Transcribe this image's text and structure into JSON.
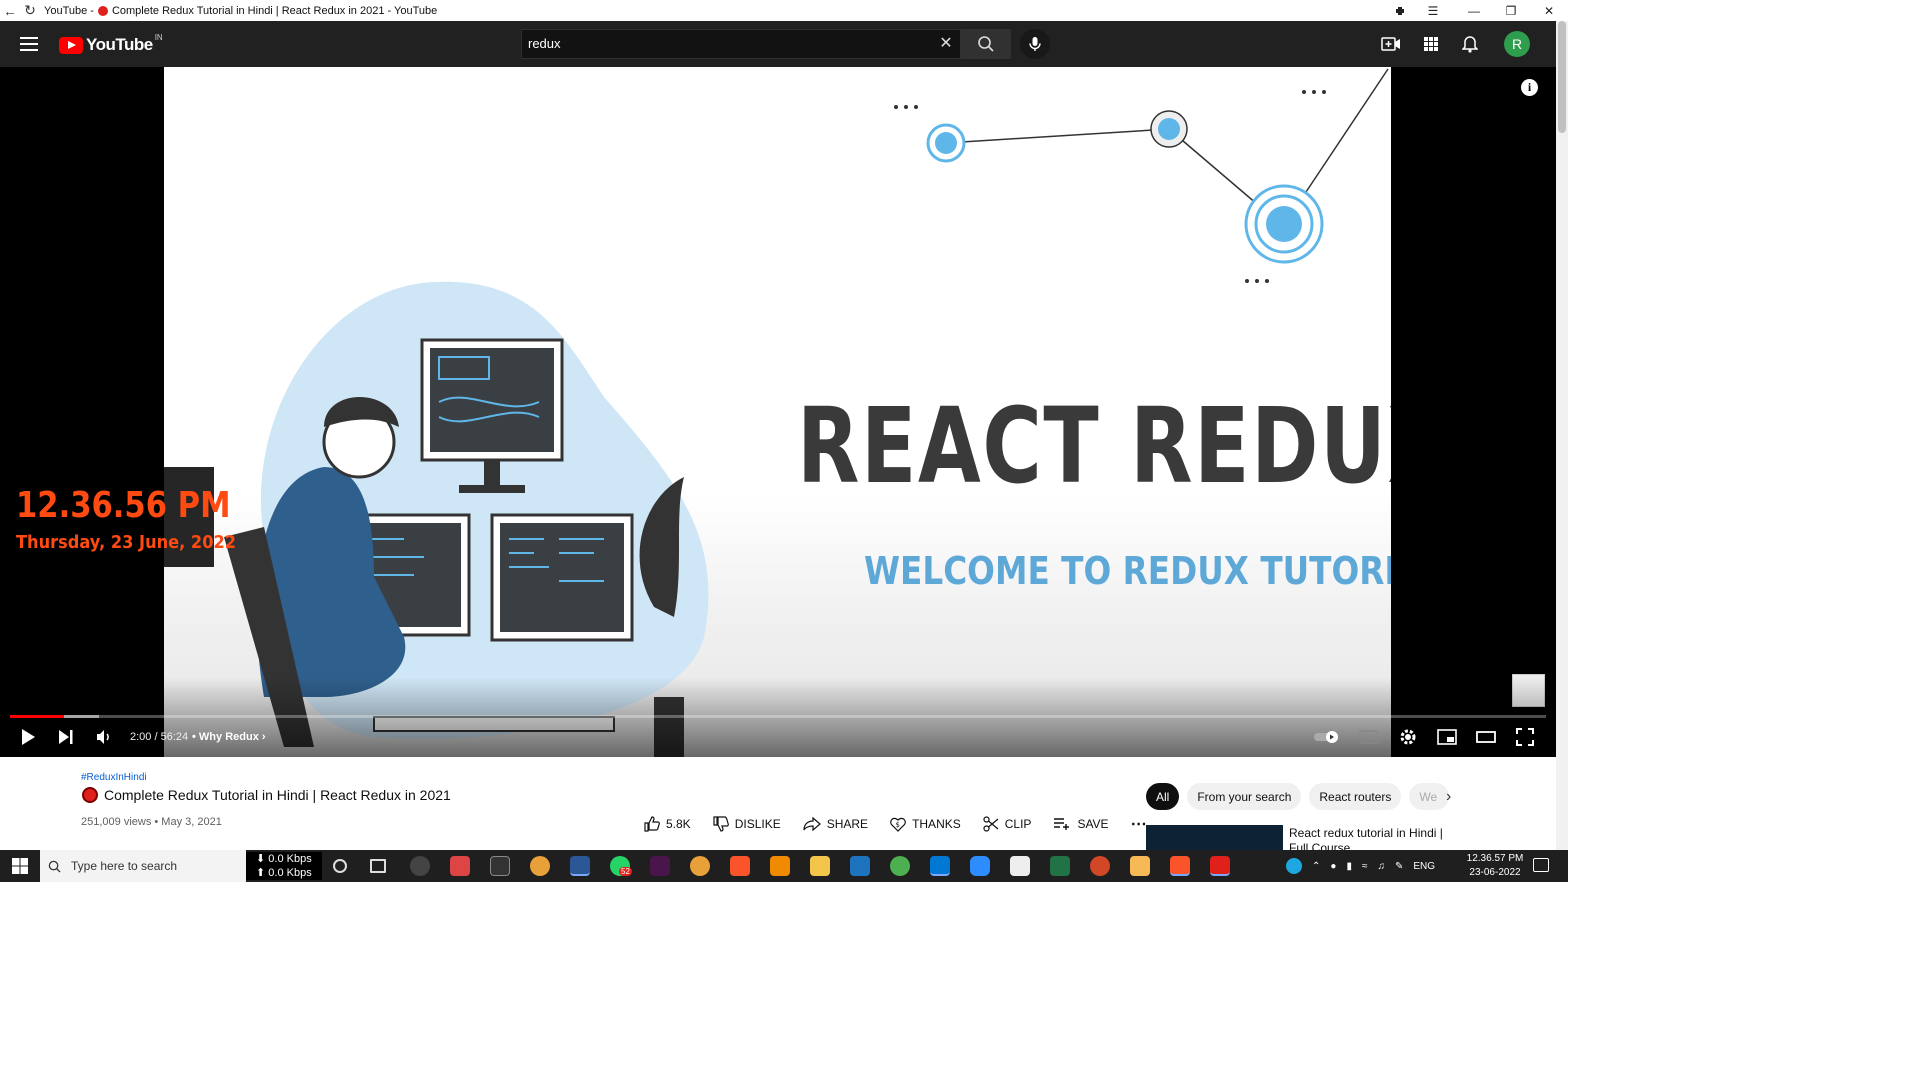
{
  "window": {
    "title": "YouTube - 🔴 Complete Redux Tutorial in Hindi | React Redux in 2021 - YouTube",
    "title_prefix": "YouTube -",
    "title_main": "Complete Redux Tutorial in Hindi | React Redux in 2021 - YouTube",
    "controls": [
      "minimize-icon",
      "restore-icon",
      "close-icon"
    ]
  },
  "masthead": {
    "logo_text": "YouTube",
    "logo_region": "IN",
    "search_value": "redux",
    "icons": [
      "menu-icon",
      "search-icon",
      "mic-icon",
      "create-icon",
      "apps-icon",
      "bell-icon"
    ],
    "avatar_letter": "R",
    "avatar_color": "#2e9d4e"
  },
  "player": {
    "thumbnail_headline": "REACT REDUX",
    "thumbnail_subheadline": "WELCOME TO REDUX TUTORIAL",
    "overlay_clock_time": "12.36.56 PM",
    "overlay_clock_date": "Thursday, 23 June, 2022",
    "time_display": "2:00 / 56:24",
    "separator": "•",
    "chapter": "Why Redux",
    "progress_played_fraction": 0.035,
    "progress_loaded_fraction": 0.058,
    "accent_color": "#ff0000"
  },
  "video": {
    "hashtag": "#ReduxInHindi",
    "title": "Complete Redux Tutorial in Hindi | React Redux in 2021",
    "meta": "251,009 views • May 3, 2021",
    "actions": {
      "likes": "5.8K",
      "dislike": "DISLIKE",
      "share": "SHARE",
      "thanks": "THANKS",
      "clip": "CLIP",
      "save": "SAVE"
    }
  },
  "sidebar": {
    "chips": [
      "All",
      "From your search",
      "React routers",
      "We"
    ],
    "recommendation_title": "React redux tutorial in Hindi | Full Course"
  },
  "taskbar": {
    "search_placeholder": "Type here to search",
    "net_up": "⬇ 0.0 Kbps",
    "net_down": "⬆ 0.0 Kbps",
    "badge_count": "52",
    "language": "ENG",
    "clock_time": "12.36.57 PM",
    "clock_date": "23-06-2022"
  }
}
